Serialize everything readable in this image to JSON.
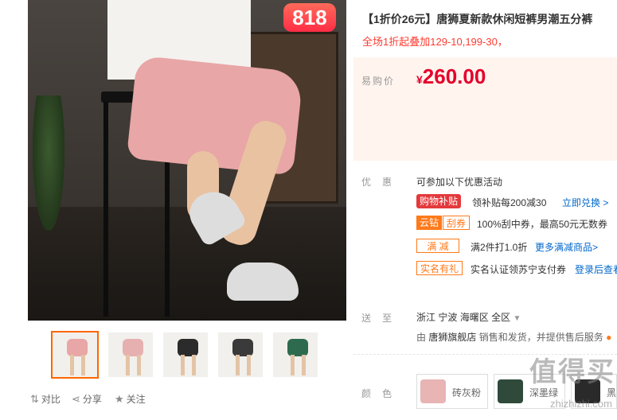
{
  "badge": "818",
  "title": "【1折价26元】唐狮夏新款休闲短裤男潮五分裤",
  "subtitle": "全场1折起叠加129-10,199-30，",
  "price": {
    "label": "易购价",
    "symbol": "¥",
    "value": "260.00"
  },
  "promo": {
    "label": "优惠",
    "intro": "可参加以下优惠活动",
    "rows": [
      {
        "tags": [
          "购物补贴"
        ],
        "text": "领补贴每200减30",
        "link": "立即兑换 >"
      },
      {
        "tags": [
          "云钻",
          "刮券"
        ],
        "text": "100%刮中券，最高50元无数券",
        "link": ""
      },
      {
        "tags": [
          "满 减"
        ],
        "text": "满2件打1.0折",
        "link": "更多满减商品>"
      },
      {
        "tags": [
          "实名有礼"
        ],
        "text": "实名认证领苏宁支付券",
        "link": "登录后查看"
      }
    ]
  },
  "delivery": {
    "label": "送至",
    "region": [
      "浙江",
      "宁波",
      "海曙区",
      "全区"
    ],
    "seller_prefix": "由",
    "seller": "唐狮旗舰店",
    "seller_suffix": "销售和发货，并提供售后服务"
  },
  "color": {
    "label": "颜色",
    "options": [
      {
        "name": "砖灰粉",
        "swatch": "#e8b4b4"
      },
      {
        "name": "深墨绿",
        "swatch": "#2f4a3a"
      },
      {
        "name": "黑",
        "swatch": "#2a2a2a"
      }
    ]
  },
  "thumbnails": [
    {
      "shorts_color": "#e8a6a6",
      "active": true
    },
    {
      "shorts_color": "#e6b0b0",
      "active": false
    },
    {
      "shorts_color": "#2b2b2b",
      "active": false
    },
    {
      "shorts_color": "#3a3a3a",
      "active": false
    },
    {
      "shorts_color": "#2e6b4e",
      "active": false
    }
  ],
  "actions": {
    "compare": "对比",
    "share": "分享",
    "follow": "关注"
  },
  "watermark": {
    "text": "值得买",
    "url": "zhizhizhi.com"
  },
  "colors": {
    "accent": "#e4002b",
    "orange": "#ff7a1a",
    "price_bg": "#fff4ee",
    "link": "#0067cc"
  }
}
